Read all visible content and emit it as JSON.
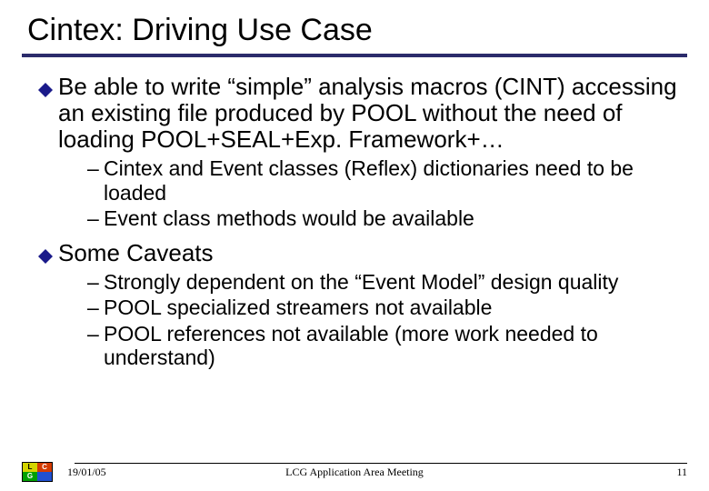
{
  "title": "Cintex: Driving Use Case",
  "bullets": [
    {
      "text": "Be able to write “simple” analysis macros (CINT) accessing an existing file produced by POOL without the need of loading POOL+SEAL+Exp. Framework+…",
      "subs": [
        "Cintex and Event classes (Reflex) dictionaries need to be loaded",
        "Event class methods would be available"
      ]
    },
    {
      "text": "Some Caveats",
      "subs": [
        "Strongly dependent on the “Event Model” design quality",
        "POOL specialized streamers not available",
        "POOL references not available (more work needed to understand)"
      ]
    }
  ],
  "logo": {
    "a": "L",
    "b": "C",
    "c": "G",
    "d": ""
  },
  "footer": {
    "date": "19/01/05",
    "center": "LCG Application Area Meeting",
    "page": "11"
  }
}
